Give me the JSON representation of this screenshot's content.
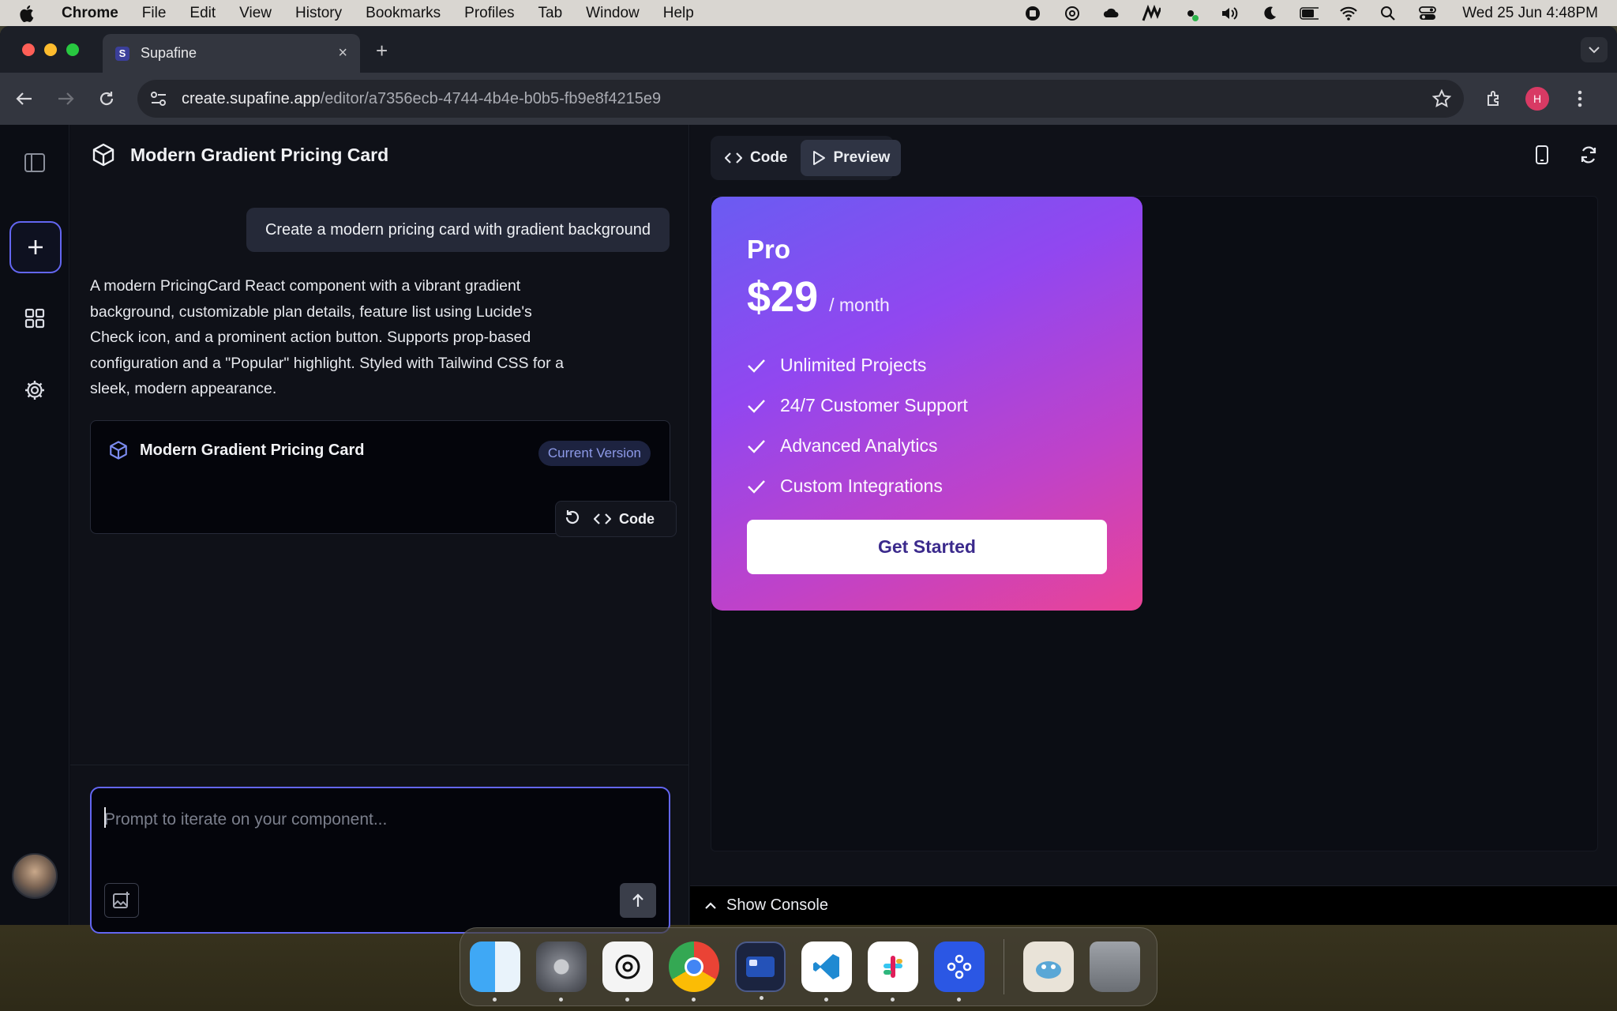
{
  "menubar": {
    "app_name": "Chrome",
    "items": [
      "File",
      "Edit",
      "View",
      "History",
      "Bookmarks",
      "Profiles",
      "Tab",
      "Window",
      "Help"
    ],
    "clock": "Wed 25 Jun  4:48PM"
  },
  "browser": {
    "tab_title": "Supafine",
    "tab_favicon": "S",
    "url_host": "create.supafine.app",
    "url_path": "/editor/a7356ecb-4744-4b4e-b0b5-fb9e8f4215e9",
    "profile_initial": "H"
  },
  "chat": {
    "title": "Modern Gradient Pricing Card",
    "user_message": "Create a modern pricing card with gradient background",
    "assistant_message": "A modern PricingCard React component with a vibrant gradient background, customizable plan details, feature list using Lucide's Check icon, and a prominent action button. Supports prop-based configuration and a \"Popular\" highlight. Styled with Tailwind CSS for a sleek, modern appearance.",
    "version_card": {
      "title": "Modern Gradient Pricing Card",
      "badge": "Current Version",
      "code_label": "Code"
    },
    "prompt_placeholder": "Prompt to iterate on your component..."
  },
  "preview": {
    "tabs": {
      "code": "Code",
      "preview": "Preview"
    },
    "card": {
      "plan": "Pro",
      "price": "$29",
      "period": "/ month",
      "features": [
        "Unlimited Projects",
        "24/7 Customer Support",
        "Advanced Analytics",
        "Custom Integrations"
      ],
      "cta": "Get Started"
    },
    "console_label": "Show Console"
  },
  "colors": {
    "accent": "#6366f1",
    "gradient_start": "#6a5cf2",
    "gradient_end": "#ea4396"
  }
}
